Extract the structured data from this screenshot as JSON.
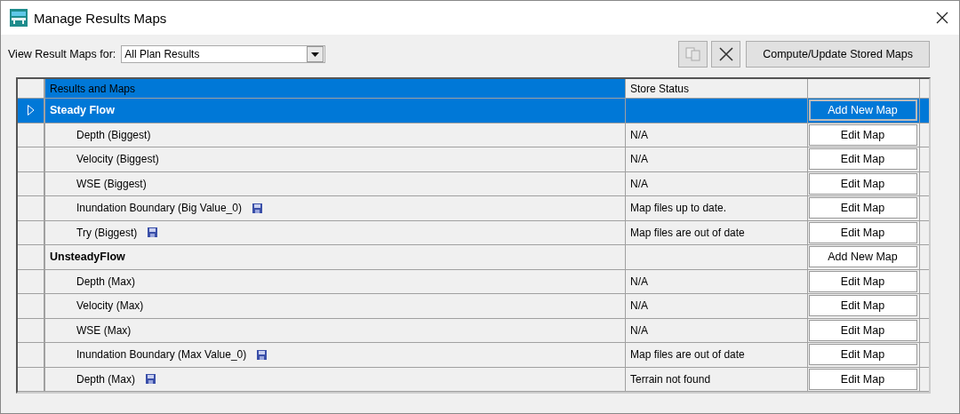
{
  "window": {
    "title": "Manage Results Maps"
  },
  "filter": {
    "label": "View Result Maps for:",
    "value": "All Plan Results"
  },
  "toolbar": {
    "copy_disabled": true,
    "compute_button": "Compute/Update Stored Maps"
  },
  "table": {
    "columns": [
      {
        "label": "Results and Maps",
        "selected": true
      },
      {
        "label": "Store Status",
        "selected": false
      }
    ],
    "rows": [
      {
        "kind": "group",
        "name": "Steady Flow",
        "status": "",
        "action": "Add New Map",
        "stored": false,
        "selected": true
      },
      {
        "kind": "map",
        "name": "Depth (Biggest)",
        "status": "N/A",
        "action": "Edit Map",
        "stored": false,
        "selected": false
      },
      {
        "kind": "map",
        "name": "Velocity (Biggest)",
        "status": "N/A",
        "action": "Edit Map",
        "stored": false,
        "selected": false
      },
      {
        "kind": "map",
        "name": "WSE (Biggest)",
        "status": "N/A",
        "action": "Edit Map",
        "stored": false,
        "selected": false
      },
      {
        "kind": "map",
        "name": "Inundation Boundary (Big Value_0)",
        "status": "Map files up to date.",
        "action": "Edit Map",
        "stored": true,
        "selected": false
      },
      {
        "kind": "map",
        "name": "Try (Biggest)",
        "status": "Map files are out of date",
        "action": "Edit Map",
        "stored": true,
        "selected": false
      },
      {
        "kind": "group",
        "name": "UnsteadyFlow",
        "status": "",
        "action": "Add New Map",
        "stored": false,
        "selected": false
      },
      {
        "kind": "map",
        "name": "Depth (Max)",
        "status": "N/A",
        "action": "Edit Map",
        "stored": false,
        "selected": false
      },
      {
        "kind": "map",
        "name": "Velocity (Max)",
        "status": "N/A",
        "action": "Edit Map",
        "stored": false,
        "selected": false
      },
      {
        "kind": "map",
        "name": "WSE (Max)",
        "status": "N/A",
        "action": "Edit Map",
        "stored": false,
        "selected": false
      },
      {
        "kind": "map",
        "name": "Inundation Boundary (Max Value_0)",
        "status": "Map files are out of date",
        "action": "Edit Map",
        "stored": true,
        "selected": false
      },
      {
        "kind": "map",
        "name": "Depth (Max)",
        "status": "Terrain not found",
        "action": "Edit Map",
        "stored": true,
        "selected": false
      }
    ]
  }
}
